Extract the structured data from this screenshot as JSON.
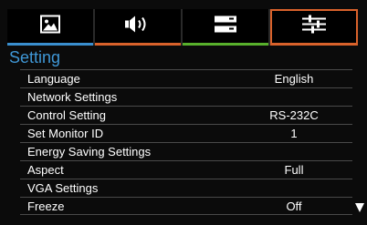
{
  "tabs": [
    {
      "icon": "picture-icon",
      "underline": "#3a8fcf",
      "active": false
    },
    {
      "icon": "audio-speaker-icon",
      "underline": "#d9622b",
      "active": false
    },
    {
      "icon": "setup-panel-icon",
      "underline": "#58b02c",
      "active": false
    },
    {
      "icon": "equalizer-sliders-icon",
      "underline": "#d9622b",
      "active": true
    }
  ],
  "section_title": "Setting",
  "menu": [
    {
      "label": "Language",
      "value": "English"
    },
    {
      "label": "Network Settings",
      "value": ""
    },
    {
      "label": "Control Setting",
      "value": "RS-232C"
    },
    {
      "label": "Set Monitor ID",
      "value": "1"
    },
    {
      "label": "Energy Saving Settings",
      "value": ""
    },
    {
      "label": "Aspect",
      "value": "Full"
    },
    {
      "label": "VGA Settings",
      "value": ""
    },
    {
      "label": "Freeze",
      "value": "Off"
    }
  ],
  "colors": {
    "title": "#3f97d6",
    "accent": "#d9622b"
  }
}
